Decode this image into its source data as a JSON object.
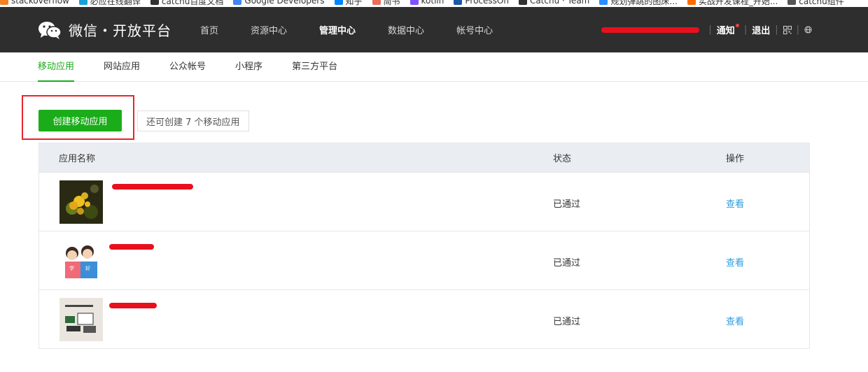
{
  "bookmarks": [
    {
      "label": "stackoverflow",
      "color": "#f48024"
    },
    {
      "label": "必应在线翻译",
      "color": "#1aa0d8"
    },
    {
      "label": "catchu百度文档",
      "color": "#333333"
    },
    {
      "label": "Google Developers",
      "color": "#4285f4"
    },
    {
      "label": "知乎",
      "color": "#0084ff"
    },
    {
      "label": "简书",
      "color": "#ea6f5a"
    },
    {
      "label": "kotlin",
      "color": "#7f52ff"
    },
    {
      "label": "ProcessOn",
      "color": "#1a5aa6"
    },
    {
      "label": "Catchu · Team",
      "color": "#333333"
    },
    {
      "label": "规划弹跳的图床...",
      "color": "#2b8cff"
    },
    {
      "label": "实战开发课程_开始...",
      "color": "#ff6a00"
    },
    {
      "label": "catchu组件",
      "color": "#555555"
    }
  ],
  "header": {
    "logo_text": "微信・开放平台",
    "nav": [
      {
        "label": "首页",
        "active": false
      },
      {
        "label": "资源中心",
        "active": false
      },
      {
        "label": "管理中心",
        "active": true
      },
      {
        "label": "数据中心",
        "active": false
      },
      {
        "label": "帐号中心",
        "active": false
      }
    ],
    "notify_label": "通知",
    "logout_label": "退出",
    "qr_icon": "qr-code-icon",
    "globe_icon": "globe-icon"
  },
  "subnav": {
    "tabs": [
      {
        "label": "移动应用",
        "active": true
      },
      {
        "label": "网站应用",
        "active": false
      },
      {
        "label": "公众帐号",
        "active": false
      },
      {
        "label": "小程序",
        "active": false
      },
      {
        "label": "第三方平台",
        "active": false
      }
    ]
  },
  "actions": {
    "create_label": "创建移动应用",
    "quota_text": "还可创建 7 个移动应用"
  },
  "table": {
    "headers": {
      "name": "应用名称",
      "status": "状态",
      "op": "操作"
    },
    "rows": [
      {
        "status": "已通过",
        "op": "查看"
      },
      {
        "status": "已通过",
        "op": "查看"
      },
      {
        "status": "已通过",
        "op": "查看"
      }
    ]
  },
  "colors": {
    "brand_green": "#1aad19",
    "link_blue": "#2d9cdb",
    "nav_bg": "#2e2e2e",
    "highlight_red": "#e8242b"
  }
}
